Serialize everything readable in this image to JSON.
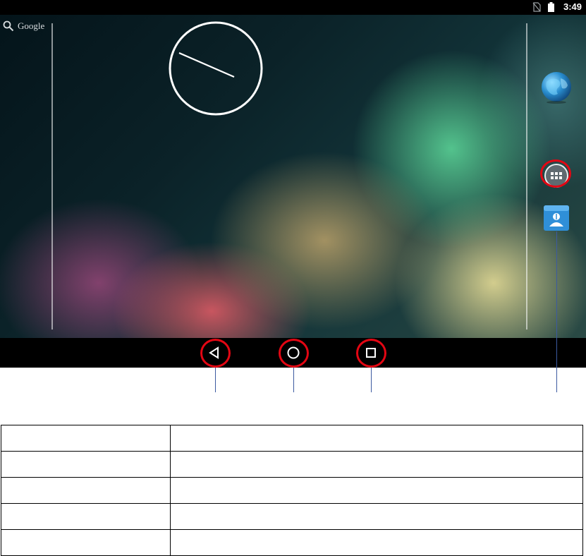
{
  "status_bar": {
    "time": "3:49",
    "icons": [
      "no-sim-icon",
      "battery-icon"
    ]
  },
  "home_screen": {
    "search_label": "Google",
    "clock_widget": "analog-clock-icon",
    "dock_icons": [
      "browser-globe-icon",
      "app-drawer-icon",
      "contacts-app-icon"
    ]
  },
  "nav_bar": {
    "buttons": [
      "back-icon",
      "home-icon",
      "recents-icon"
    ]
  },
  "annotation": {
    "ring_color": "#e30613",
    "line_color": "#3c5aa0"
  },
  "legend_table": {
    "rows": [
      [
        "",
        ""
      ],
      [
        "",
        ""
      ],
      [
        "",
        ""
      ],
      [
        "",
        ""
      ],
      [
        "",
        ""
      ]
    ]
  }
}
